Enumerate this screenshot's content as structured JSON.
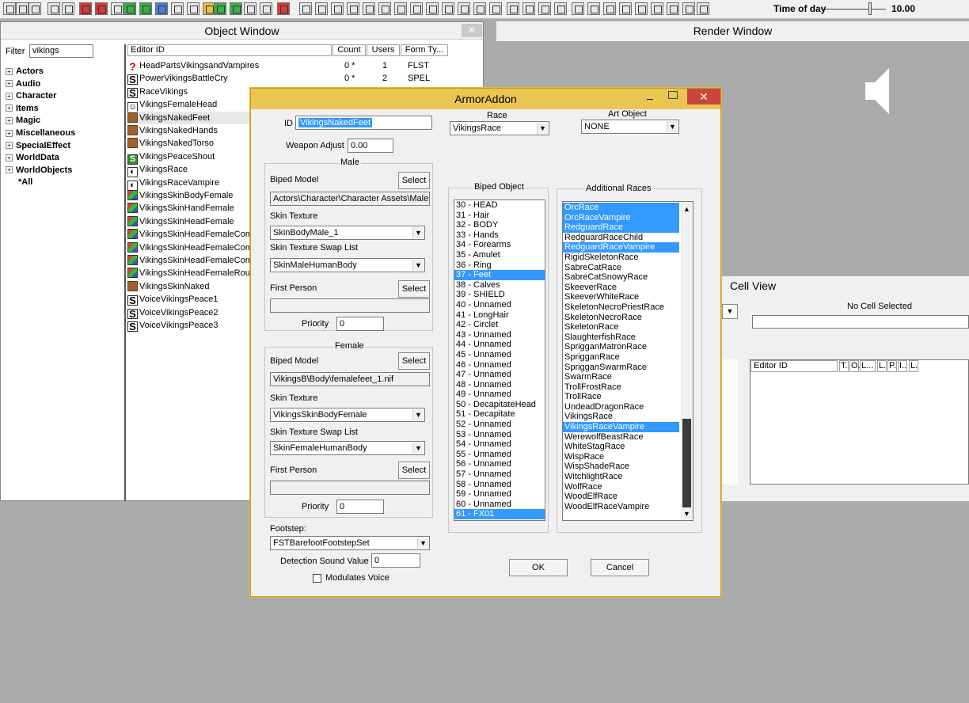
{
  "toolbar": {
    "time_label": "Time of day",
    "time_value": "10.00"
  },
  "object_window": {
    "title": "Object Window",
    "close": "✕",
    "filter_label": "Filter",
    "filter_value": "vikings",
    "tree": [
      "Actors",
      "Audio",
      "Character",
      "Items",
      "Magic",
      "Miscellaneous",
      "SpecialEffect",
      "WorldData",
      "WorldObjects",
      "*All"
    ],
    "columns": [
      "Editor ID",
      "Count",
      "Users",
      "Form Ty..."
    ],
    "rows": [
      {
        "icon": "formlist",
        "id": "HeadPartsVikingsandVampires",
        "count": "0 *",
        "users": "1",
        "type": "FLST"
      },
      {
        "icon": "spell",
        "id": "PowerVikingsBattleCry",
        "count": "0 *",
        "users": "2",
        "type": "SPEL"
      },
      {
        "icon": "spell",
        "id": "RaceVikings",
        "count": "",
        "users": "",
        "type": ""
      },
      {
        "icon": "headpart",
        "id": "VikingsFemaleHead",
        "count": "",
        "users": "",
        "type": ""
      },
      {
        "icon": "armoraddon",
        "id": "VikingsNakedFeet",
        "count": "",
        "users": "",
        "type": ""
      },
      {
        "icon": "armoraddon",
        "id": "VikingsNakedHands",
        "count": "",
        "users": "",
        "type": ""
      },
      {
        "icon": "armoraddon",
        "id": "VikingsNakedTorso",
        "count": "",
        "users": "",
        "type": ""
      },
      {
        "icon": "shout",
        "id": "VikingsPeaceShout",
        "count": "",
        "users": "",
        "type": ""
      },
      {
        "icon": "race",
        "id": "VikingsRace",
        "count": "",
        "users": "",
        "type": ""
      },
      {
        "icon": "race",
        "id": "VikingsRaceVampire",
        "count": "",
        "users": "",
        "type": ""
      },
      {
        "icon": "texture",
        "id": "VikingsSkinBodyFemale",
        "count": "",
        "users": "",
        "type": ""
      },
      {
        "icon": "texture",
        "id": "VikingsSkinHandFemale",
        "count": "",
        "users": "",
        "type": ""
      },
      {
        "icon": "texture",
        "id": "VikingsSkinHeadFemale",
        "count": "",
        "users": "",
        "type": ""
      },
      {
        "icon": "texture",
        "id": "VikingsSkinHeadFemaleComp",
        "count": "",
        "users": "",
        "type": ""
      },
      {
        "icon": "texture",
        "id": "VikingsSkinHeadFemaleComp",
        "count": "",
        "users": "",
        "type": ""
      },
      {
        "icon": "texture",
        "id": "VikingsSkinHeadFemaleComp",
        "count": "",
        "users": "",
        "type": ""
      },
      {
        "icon": "texture",
        "id": "VikingsSkinHeadFemaleRougl",
        "count": "",
        "users": "",
        "type": ""
      },
      {
        "icon": "armor",
        "id": "VikingsSkinNaked",
        "count": "",
        "users": "",
        "type": ""
      },
      {
        "icon": "spell",
        "id": "VoiceVikingsPeace1",
        "count": "",
        "users": "",
        "type": ""
      },
      {
        "icon": "spell",
        "id": "VoiceVikingsPeace2",
        "count": "",
        "users": "",
        "type": ""
      },
      {
        "icon": "spell",
        "id": "VoiceVikingsPeace3",
        "count": "",
        "users": "",
        "type": ""
      }
    ]
  },
  "render_window": {
    "title": "Render Window"
  },
  "cell_view": {
    "title": "Cell View",
    "no_cell": "No Cell Selected",
    "columns": [
      "Editor ID",
      "T.",
      "O.",
      "L...",
      "L.",
      "P.",
      "I..",
      "L."
    ]
  },
  "dialog": {
    "title": "ArmorAddon",
    "minimize": "–",
    "close": "✕",
    "id_label": "ID",
    "id_value": "VikingsNakedFeet",
    "weapon_adjust_label": "Weapon Adjust",
    "weapon_adjust_value": "0.00",
    "race_label": "Race",
    "race_value": "VikingsRace",
    "art_object_label": "Art Object",
    "art_object_value": "NONE",
    "male": {
      "group": "Male",
      "biped_model_label": "Biped Model",
      "select": "Select",
      "biped_model_path": "Actors\\Character\\Character Assets\\MaleFe",
      "skin_texture_label": "Skin Texture",
      "skin_texture": "SkinBodyMale_1",
      "swap_list_label": "Skin Texture Swap List",
      "swap_list": "SkinMaleHumanBody",
      "first_person_label": "First Person",
      "first_person_path": "",
      "priority_label": "Priority",
      "priority": "0"
    },
    "female": {
      "group": "Female",
      "biped_model_label": "Biped Model",
      "select": "Select",
      "biped_model_path": "VikingsB\\Body\\femalefeet_1.nif",
      "skin_texture_label": "Skin Texture",
      "skin_texture": "VikingsSkinBodyFemale",
      "swap_list_label": "Skin Texture Swap List",
      "swap_list": "SkinFemaleHumanBody",
      "first_person_label": "First Person",
      "first_person_path": "",
      "priority_label": "Priority",
      "priority": "0"
    },
    "footstep_label": "Footstep:",
    "footstep_value": "FSTBarefootFootstepSet",
    "detection_label": "Detection Sound Value",
    "detection_value": "0",
    "modulates_voice_label": "Modulates Voice",
    "biped_object_label": "Biped Object",
    "biped_objects": [
      {
        "t": "30 - HEAD",
        "sel": false
      },
      {
        "t": "31 - Hair",
        "sel": false
      },
      {
        "t": "32 - BODY",
        "sel": false
      },
      {
        "t": "33 - Hands",
        "sel": false
      },
      {
        "t": "34 - Forearms",
        "sel": false
      },
      {
        "t": "35 - Amulet",
        "sel": false
      },
      {
        "t": "36 - Ring",
        "sel": false
      },
      {
        "t": "37 - Feet",
        "sel": true
      },
      {
        "t": "38 - Calves",
        "sel": false
      },
      {
        "t": "39 - SHIELD",
        "sel": false
      },
      {
        "t": "40 - Unnamed",
        "sel": false
      },
      {
        "t": "41 - LongHair",
        "sel": false
      },
      {
        "t": "42 - Circlet",
        "sel": false
      },
      {
        "t": "43 - Unnamed",
        "sel": false
      },
      {
        "t": "44 - Unnamed",
        "sel": false
      },
      {
        "t": "45 - Unnamed",
        "sel": false
      },
      {
        "t": "46 - Unnamed",
        "sel": false
      },
      {
        "t": "47 - Unnamed",
        "sel": false
      },
      {
        "t": "48 - Unnamed",
        "sel": false
      },
      {
        "t": "49 - Unnamed",
        "sel": false
      },
      {
        "t": "50 - DecapitateHead",
        "sel": false
      },
      {
        "t": "51 - Decapitate",
        "sel": false
      },
      {
        "t": "52 - Unnamed",
        "sel": false
      },
      {
        "t": "53 - Unnamed",
        "sel": false
      },
      {
        "t": "54 - Unnamed",
        "sel": false
      },
      {
        "t": "55 - Unnamed",
        "sel": false
      },
      {
        "t": "56 - Unnamed",
        "sel": false
      },
      {
        "t": "57 - Unnamed",
        "sel": false
      },
      {
        "t": "58 - Unnamed",
        "sel": false
      },
      {
        "t": "59 - Unnamed",
        "sel": false
      },
      {
        "t": "60 - Unnamed",
        "sel": false
      },
      {
        "t": "61 - FX01",
        "sel": true
      }
    ],
    "additional_races_label": "Additional Races",
    "additional_races": [
      {
        "t": "OrcRace",
        "sel": true
      },
      {
        "t": "OrcRaceVampire",
        "sel": true
      },
      {
        "t": "RedguardRace",
        "sel": true
      },
      {
        "t": "RedguardRaceChild",
        "sel": false
      },
      {
        "t": "RedguardRaceVampire",
        "sel": true
      },
      {
        "t": "RigidSkeletonRace",
        "sel": false
      },
      {
        "t": "SabreCatRace",
        "sel": false
      },
      {
        "t": "SabreCatSnowyRace",
        "sel": false
      },
      {
        "t": "SkeeverRace",
        "sel": false
      },
      {
        "t": "SkeeverWhiteRace",
        "sel": false
      },
      {
        "t": "SkeletonNecroPriestRace",
        "sel": false
      },
      {
        "t": "SkeletonNecroRace",
        "sel": false
      },
      {
        "t": "SkeletonRace",
        "sel": false
      },
      {
        "t": "SlaughterfishRace",
        "sel": false
      },
      {
        "t": "SprigganMatronRace",
        "sel": false
      },
      {
        "t": "SprigganRace",
        "sel": false
      },
      {
        "t": "SprigganSwarmRace",
        "sel": false
      },
      {
        "t": "SwarmRace",
        "sel": false
      },
      {
        "t": "TrollFrostRace",
        "sel": false
      },
      {
        "t": "TrollRace",
        "sel": false
      },
      {
        "t": "UndeadDragonRace",
        "sel": false
      },
      {
        "t": "VikingsRace",
        "sel": false
      },
      {
        "t": "VikingsRaceVampire",
        "sel": true
      },
      {
        "t": "WerewolfBeastRace",
        "sel": false
      },
      {
        "t": "WhiteStagRace",
        "sel": false
      },
      {
        "t": "WispRace",
        "sel": false
      },
      {
        "t": "WispShadeRace",
        "sel": false
      },
      {
        "t": "WitchlightRace",
        "sel": false
      },
      {
        "t": "WolfRace",
        "sel": false
      },
      {
        "t": "WoodElfRace",
        "sel": false
      },
      {
        "t": "WoodElfRaceVampire",
        "sel": false
      }
    ],
    "ok": "OK",
    "cancel": "Cancel"
  }
}
